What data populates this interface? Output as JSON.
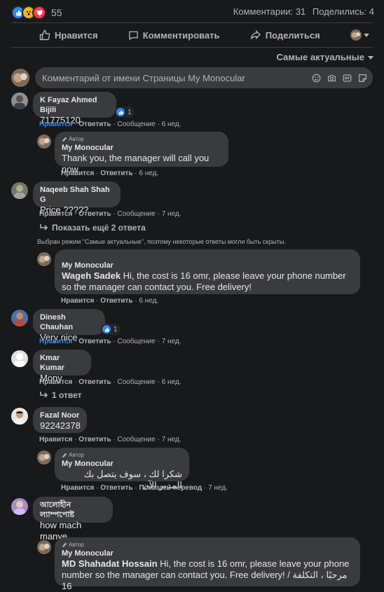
{
  "reactions": {
    "count": "55",
    "icons": [
      "like-icon",
      "wow-icon",
      "love-icon"
    ]
  },
  "stats": {
    "comments": "Комментарии: 31",
    "shares": "Поделились: 4"
  },
  "actions": {
    "like": "Нравится",
    "comment": "Комментировать",
    "share": "Поделиться"
  },
  "sort": {
    "label": "Самые актуальные"
  },
  "composer": {
    "placeholder": "Комментарий от имени Страницы My Monocular"
  },
  "labels": {
    "like": "Нравится",
    "reply": "Ответить",
    "message": "Сообщение",
    "translate": "Показать перевод",
    "author": "Автор",
    "sep": "·"
  },
  "comments": [
    {
      "name": "K Fayaz Ahmed Bijili",
      "text": "71775120",
      "time": "6 нед.",
      "likes": "1"
    },
    {
      "name": "My Monocular",
      "text": "Thank you, the manager will call you now",
      "time": "6 нед."
    },
    {
      "name": "Naqeeb Shah Shah G",
      "text": "Price ?????",
      "time": "7 нед."
    },
    {
      "name": "My Monocular",
      "mention": "Wageh Sadek",
      "text": " Hi, the cost is 16 omr, please leave your phone number so the manager can contact you. Free delivery!",
      "time": "6 нед."
    },
    {
      "name": "Dinesh Chauhan",
      "text": "Very nice",
      "time": "7 нед.",
      "likes": "1"
    },
    {
      "name": "Kmar Kumar",
      "text": "Mony",
      "time": "6 нед."
    },
    {
      "name": "Fazal Noor",
      "text": "92242378",
      "time": "7 нед."
    },
    {
      "name": "My Monocular",
      "text": "شكرا لك ، سوف يتصل بك المدير الآن",
      "time": "7 нед."
    },
    {
      "name": "আলোহীন ল্যাম্পপোষ্ট",
      "text": "how mach manye",
      "time": "7 нед."
    },
    {
      "name": "My Monocular",
      "mention": "MD Shahadat Hossain",
      "text": " Hi, the cost is 16 omr, please leave your phone number so the manager can contact you. Free delivery! / مرحبًا ، التكلفة 16"
    }
  ],
  "more_replies": "Показать ещё 2 ответа",
  "one_reply": "1 ответ",
  "hidden_note": "Выбран режим \"Самые актуальные\", поэтому некоторые ответы могли быть скрыты.",
  "colors": {
    "background": "#18191a",
    "bubble": "#3a3b3c",
    "accent": "#2d88ff",
    "text": "#e4e6eb",
    "muted": "#b0b3b8"
  }
}
